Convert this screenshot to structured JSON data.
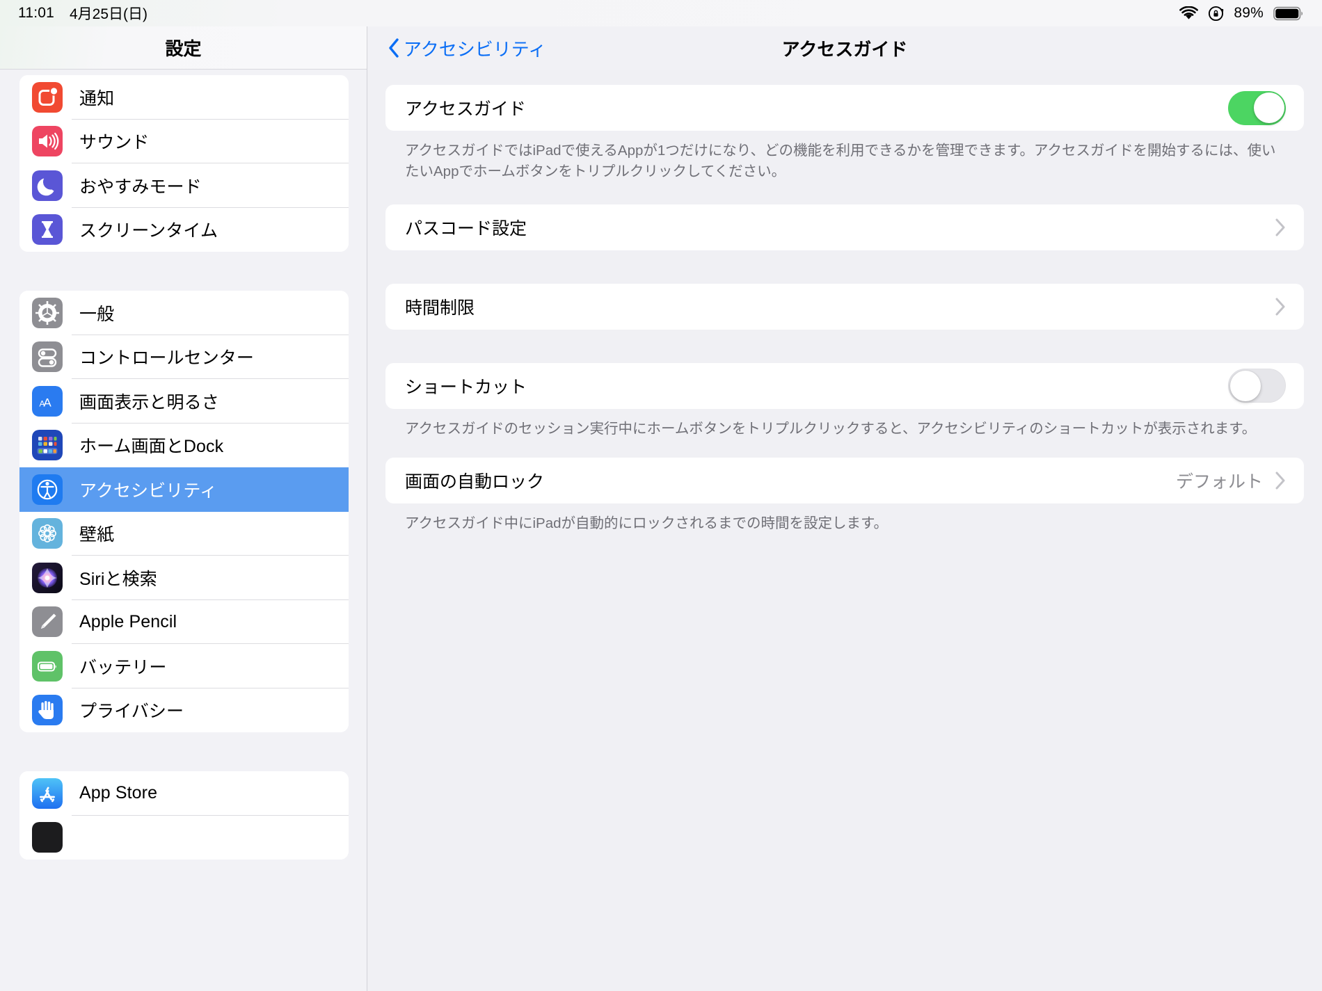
{
  "statusbar": {
    "time": "11:01",
    "date": "4月25日(日)",
    "battery_percent": "89%",
    "icons": {
      "wifi": "wifi-icon",
      "rotation_lock": "rotation-lock-icon",
      "battery": "battery-icon"
    }
  },
  "sidebar": {
    "title": "設定",
    "groups": [
      {
        "items": [
          {
            "label": "通知",
            "icon": "notifications-icon",
            "selected": false
          },
          {
            "label": "サウンド",
            "icon": "sound-icon",
            "selected": false
          },
          {
            "label": "おやすみモード",
            "icon": "do-not-disturb-icon",
            "selected": false
          },
          {
            "label": "スクリーンタイム",
            "icon": "screen-time-icon",
            "selected": false
          }
        ]
      },
      {
        "items": [
          {
            "label": "一般",
            "icon": "general-gear-icon",
            "selected": false
          },
          {
            "label": "コントロールセンター",
            "icon": "control-center-icon",
            "selected": false
          },
          {
            "label": "画面表示と明るさ",
            "icon": "display-brightness-icon",
            "selected": false
          },
          {
            "label": "ホーム画面とDock",
            "icon": "home-screen-dock-icon",
            "selected": false
          },
          {
            "label": "アクセシビリティ",
            "icon": "accessibility-icon",
            "selected": true
          },
          {
            "label": "壁紙",
            "icon": "wallpaper-icon",
            "selected": false
          },
          {
            "label": "Siriと検索",
            "icon": "siri-search-icon",
            "selected": false
          },
          {
            "label": "Apple Pencil",
            "icon": "apple-pencil-icon",
            "selected": false
          },
          {
            "label": "バッテリー",
            "icon": "battery-settings-icon",
            "selected": false
          },
          {
            "label": "プライバシー",
            "icon": "privacy-hand-icon",
            "selected": false
          }
        ]
      },
      {
        "items": [
          {
            "label": "App Store",
            "icon": "app-store-icon",
            "selected": false
          }
        ]
      }
    ]
  },
  "detail": {
    "back_label": "アクセシビリティ",
    "title": "アクセスガイド",
    "sections": [
      {
        "row": {
          "label": "アクセスガイド",
          "control": "toggle",
          "toggle_on": true
        },
        "note": "アクセスガイドではiPadで使えるAppが1つだけになり、どの機能を利用できるかを管理できます。アクセスガイドを開始するには、使いたいAppでホームボタンをトリプルクリックしてください。"
      },
      {
        "row": {
          "label": "パスコード設定",
          "control": "chevron"
        },
        "note": ""
      },
      {
        "row": {
          "label": "時間制限",
          "control": "chevron"
        },
        "note": ""
      },
      {
        "row": {
          "label": "ショートカット",
          "control": "toggle",
          "toggle_on": false
        },
        "note": "アクセスガイドのセッション実行中にホームボタンをトリプルクリックすると、アクセシビリティのショートカットが表示されます。"
      },
      {
        "row": {
          "label": "画面の自動ロック",
          "value": "デフォルト",
          "control": "chevron"
        },
        "note": "アクセスガイド中にiPadが自動的にロックされるまでの時間を設定します。"
      }
    ]
  },
  "colors": {
    "accent_blue": "#0b6ef5",
    "selection_blue": "#5a9cf0",
    "toggle_green": "#4cd562",
    "page_bg": "#f0f0f4",
    "card_bg": "#ffffff",
    "secondary_text": "#6f6f76"
  }
}
